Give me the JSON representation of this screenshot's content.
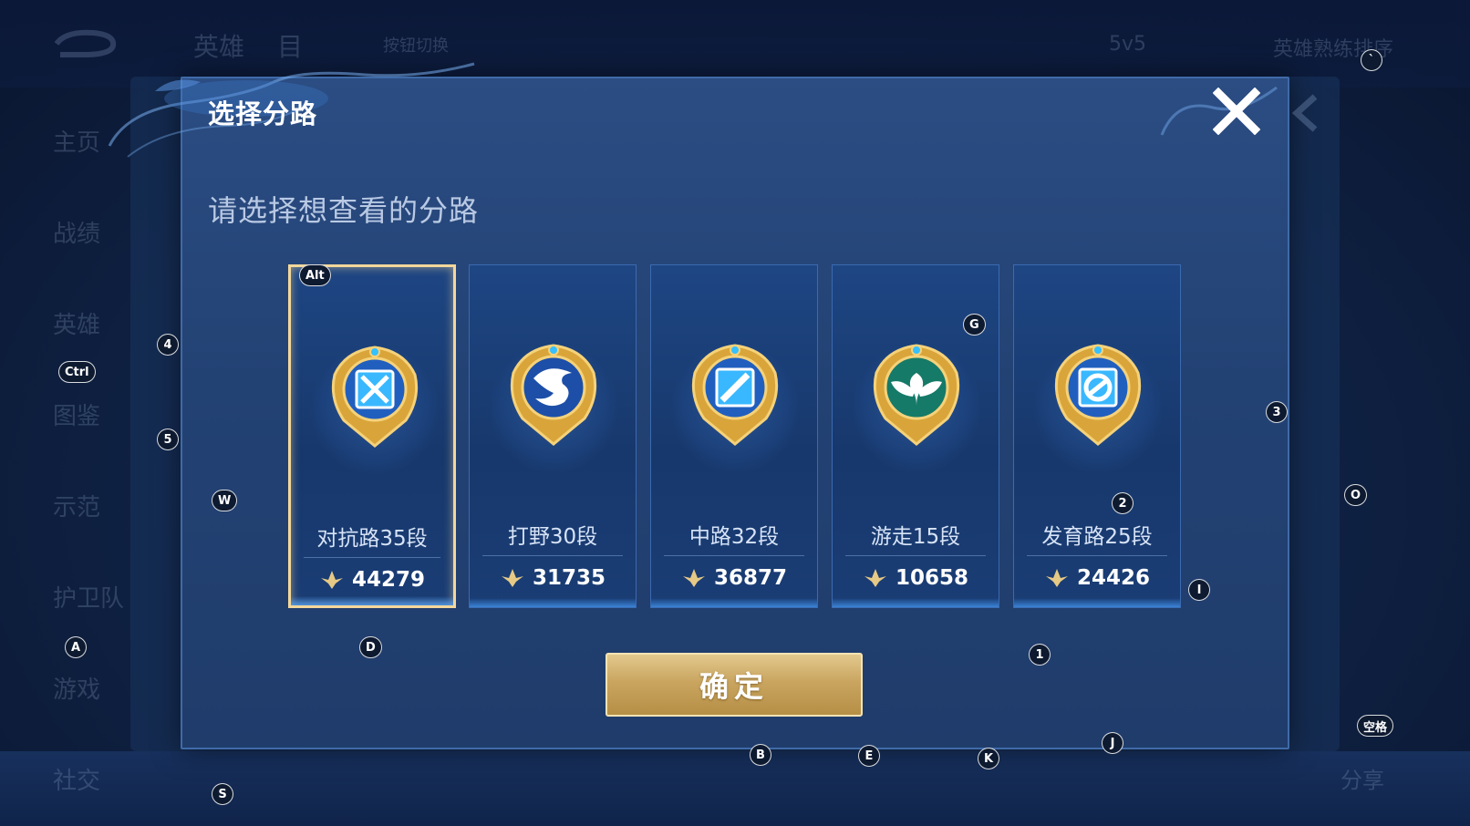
{
  "background": {
    "top_tabs": [
      "英雄",
      "目",
      "按钮切换"
    ],
    "mode": "5v5",
    "sort": "英雄熟练排序",
    "sidebar_items": [
      "主页",
      "战绩",
      "英雄",
      "图鉴",
      "示范",
      "护卫队",
      "游戏",
      "社交"
    ],
    "right_hint": "分享"
  },
  "dialog": {
    "title": "选择分路",
    "subtitle": "请选择想查看的分路",
    "confirm_label": "确定"
  },
  "lanes": [
    {
      "name": "对抗路35段",
      "score": "44279",
      "icon": "clash-lane-swords-icon",
      "selected": true
    },
    {
      "name": "打野30段",
      "score": "31735",
      "icon": "jungle-dragon-icon",
      "selected": false
    },
    {
      "name": "中路32段",
      "score": "36877",
      "icon": "mid-lane-icon",
      "selected": false
    },
    {
      "name": "游走15段",
      "score": "10658",
      "icon": "roam-wings-icon",
      "selected": false
    },
    {
      "name": "发育路25段",
      "score": "24426",
      "icon": "farm-lane-icon",
      "selected": false
    }
  ],
  "key_hints": [
    "`",
    "Alt",
    "4",
    "Ctrl",
    "5",
    "W",
    "G",
    "3",
    "O",
    "2",
    "I",
    "1",
    "A",
    "D",
    "B",
    "E",
    "K",
    "J",
    "空格",
    "S"
  ],
  "colors": {
    "accent_gold": "#e3c98e",
    "panel": "#234274",
    "selected_border": "#f3d79a",
    "teal_emblem": "#1f8a78"
  }
}
